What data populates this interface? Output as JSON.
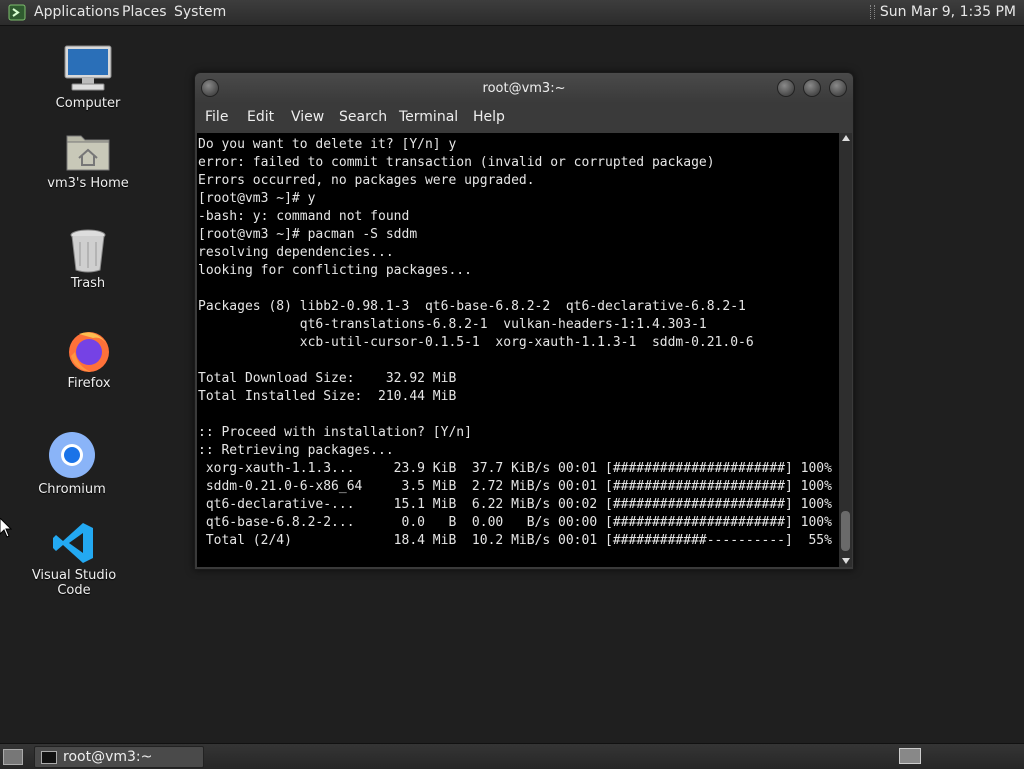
{
  "top_panel": {
    "menus": [
      "Applications",
      "Places",
      "System"
    ],
    "clock": "Sun Mar  9,  1:35 PM"
  },
  "desktop_icons": [
    {
      "label": "Computer",
      "icon": "computer-icon"
    },
    {
      "label": "vm3's Home",
      "icon": "home-folder-icon"
    },
    {
      "label": "Trash",
      "icon": "trash-icon"
    },
    {
      "label": "Firefox",
      "icon": "firefox-icon"
    },
    {
      "label": "Chromium",
      "icon": "chromium-icon"
    },
    {
      "label": "Visual Studio Code",
      "icon": "vscode-icon"
    }
  ],
  "terminal": {
    "title": "root@vm3:~",
    "menu": [
      "File",
      "Edit",
      "View",
      "Search",
      "Terminal",
      "Help"
    ],
    "lines": [
      "Do you want to delete it? [Y/n] y",
      "error: failed to commit transaction (invalid or corrupted package)",
      "Errors occurred, no packages were upgraded.",
      "[root@vm3 ~]# y",
      "-bash: y: command not found",
      "[root@vm3 ~]# pacman -S sddm",
      "resolving dependencies...",
      "looking for conflicting packages...",
      "",
      "Packages (8) libb2-0.98.1-3  qt6-base-6.8.2-2  qt6-declarative-6.8.2-1",
      "             qt6-translations-6.8.2-1  vulkan-headers-1:1.4.303-1",
      "             xcb-util-cursor-0.1.5-1  xorg-xauth-1.1.3-1  sddm-0.21.0-6",
      "",
      "Total Download Size:    32.92 MiB",
      "Total Installed Size:  210.44 MiB",
      "",
      ":: Proceed with installation? [Y/n]",
      ":: Retrieving packages...",
      " xorg-xauth-1.1.3...     23.9 KiB  37.7 KiB/s 00:01 [######################] 100%",
      " sddm-0.21.0-6-x86_64     3.5 MiB  2.72 MiB/s 00:01 [######################] 100%",
      " qt6-declarative-...     15.1 MiB  6.22 MiB/s 00:02 [######################] 100%",
      " qt6-base-6.8.2-2...      0.0   B  0.00   B/s 00:00 [######################] 100%",
      " Total (2/4)             18.4 MiB  10.2 MiB/s 00:01 [############----------]  55%"
    ]
  },
  "taskbar": {
    "task_label": "root@vm3:~"
  }
}
